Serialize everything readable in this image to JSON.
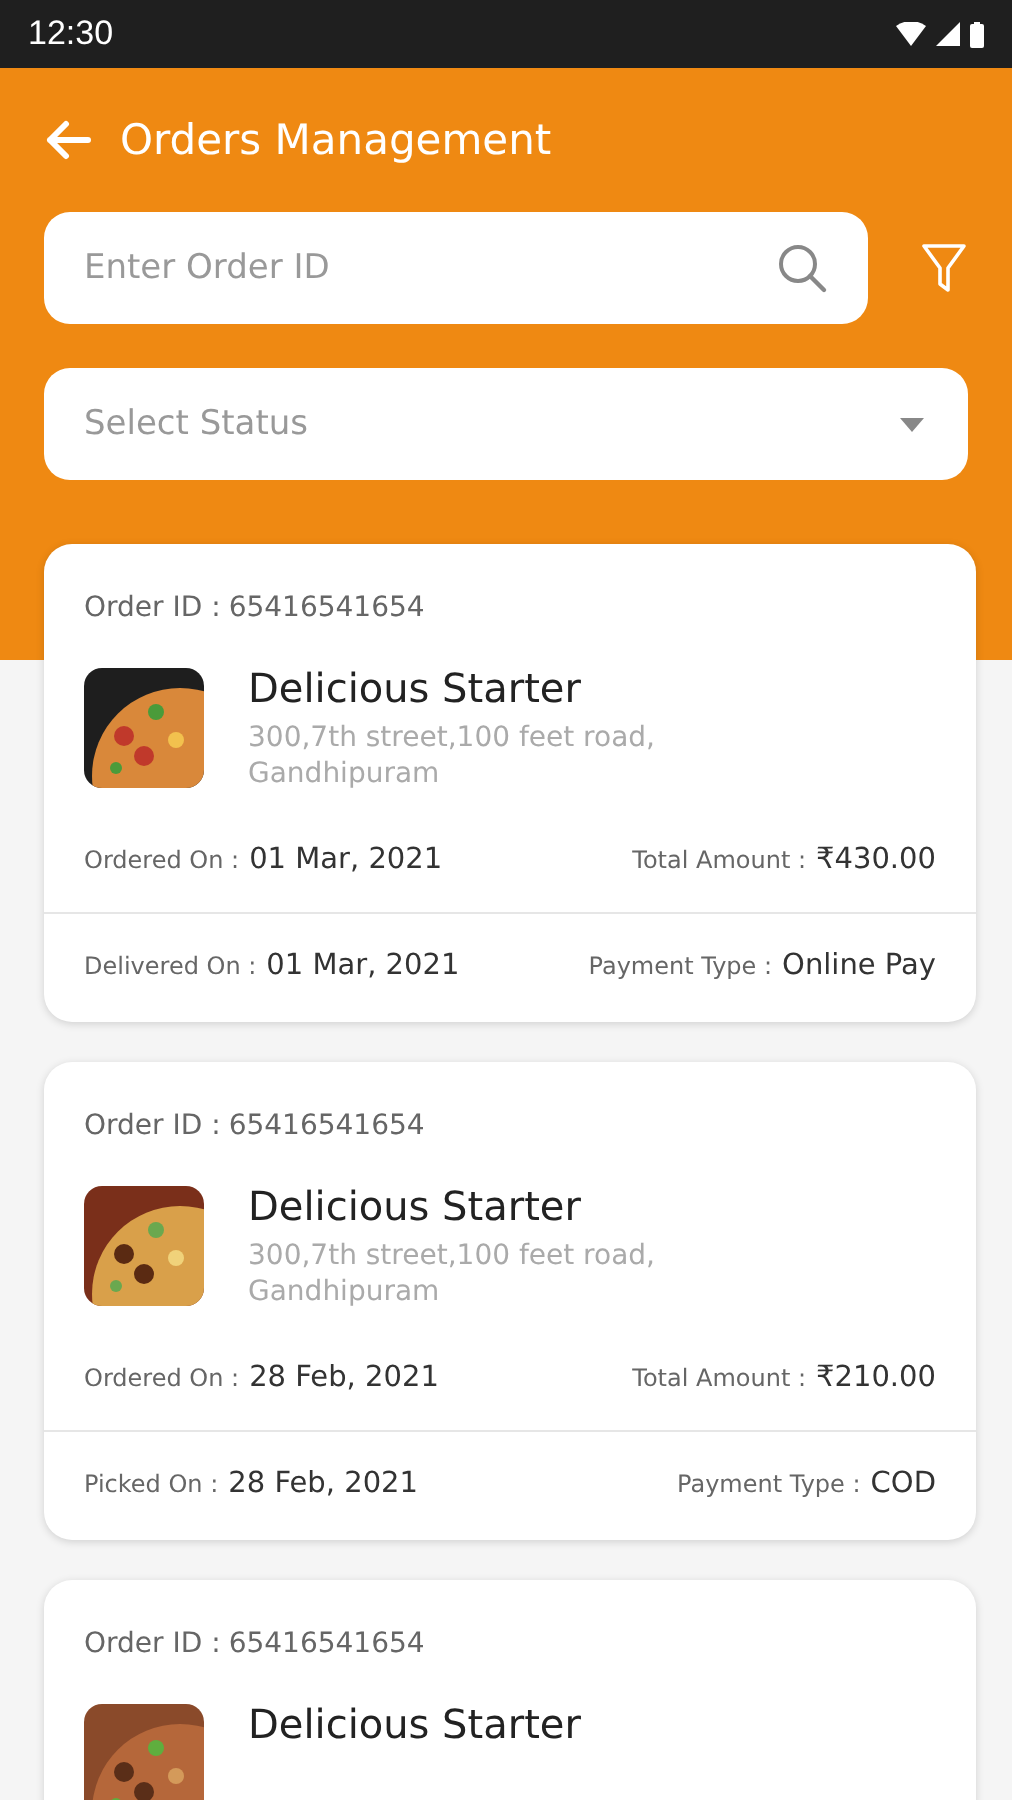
{
  "status_bar": {
    "time": "12:30"
  },
  "header": {
    "title": "Orders Management"
  },
  "search": {
    "placeholder": "Enter Order ID"
  },
  "status_select": {
    "placeholder": "Select Status"
  },
  "orders": [
    {
      "kind": "picture",
      "order_id_label": "Order ID :",
      "order_id": "65416541654",
      "name": "Delicious Starter",
      "address": "300,7th street,100 feet road, Gandhipuram",
      "rows": [
        [
          {
            "label": "Ordered On :",
            "value": "01 Mar, 2021"
          },
          {
            "label": "Total Amount :",
            "value": "₹430.00"
          }
        ],
        [
          {
            "label": "Delivered On :",
            "value": "01 Mar, 2021"
          },
          {
            "label": "Payment Type :",
            "value": "Online Pay"
          }
        ]
      ]
    },
    {
      "kind": "picture",
      "order_id_label": "Order ID :",
      "order_id": "65416541654",
      "name": "Delicious Starter",
      "address": "300,7th street,100 feet road, Gandhipuram",
      "rows": [
        [
          {
            "label": "Ordered On :",
            "value": "28 Feb, 2021"
          },
          {
            "label": "Total Amount :",
            "value": "₹210.00"
          }
        ],
        [
          {
            "label": "Picked On :",
            "value": "28 Feb, 2021"
          },
          {
            "label": "Payment Type :",
            "value": "COD"
          }
        ]
      ]
    },
    {
      "kind": "picture",
      "order_id_label": "Order ID :",
      "order_id": "65416541654",
      "name": "Delicious Starter"
    }
  ]
}
